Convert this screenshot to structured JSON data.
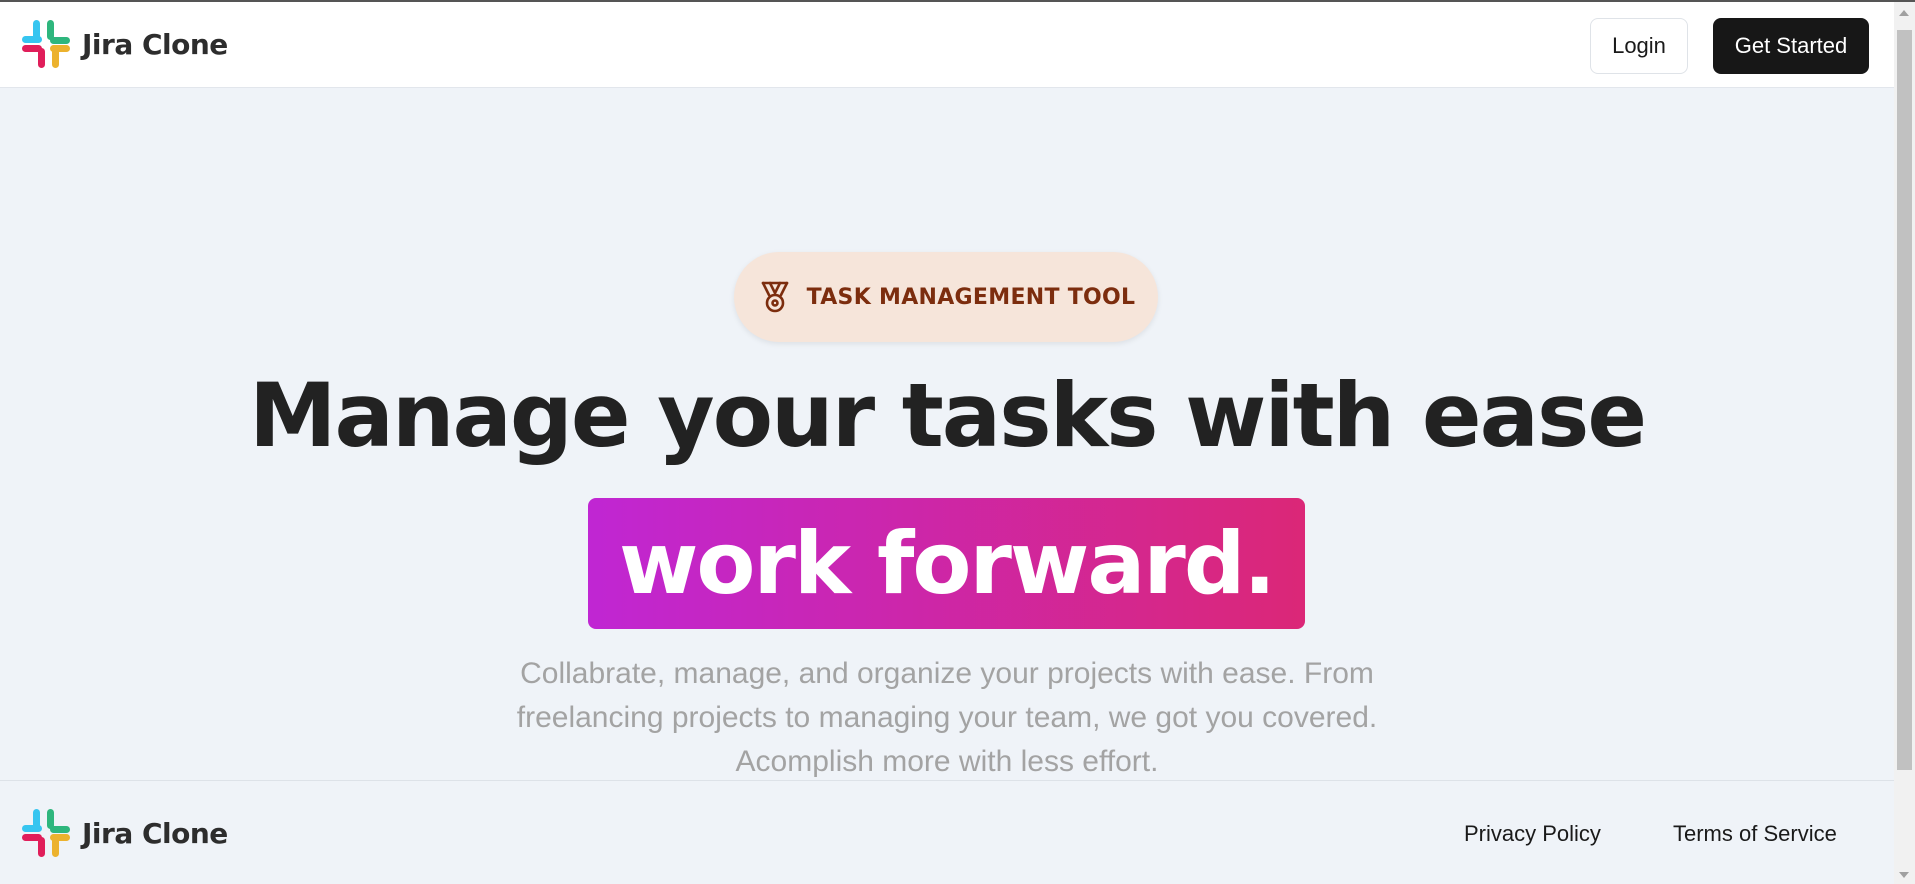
{
  "header": {
    "brand_name": "Jira Clone",
    "login_label": "Login",
    "get_started_label": "Get Started"
  },
  "hero": {
    "badge_icon": "medal-icon",
    "badge_text": "TASK MANAGEMENT TOOL",
    "headline": "Manage your tasks with ease",
    "highlight": "work forward.",
    "subtitle": "Collabrate, manage, and organize your projects with ease. From freelancing projects to managing your team, we got you covered. Acomplish more with less effort."
  },
  "footer": {
    "brand_name": "Jira Clone",
    "privacy_label": "Privacy Policy",
    "terms_label": "Terms of Service"
  },
  "colors": {
    "badge_bg": "#f6e5da",
    "badge_text": "#7c2d0e",
    "highlight_start": "#c026d3",
    "highlight_end": "#db2777",
    "primary_button": "#171717"
  }
}
